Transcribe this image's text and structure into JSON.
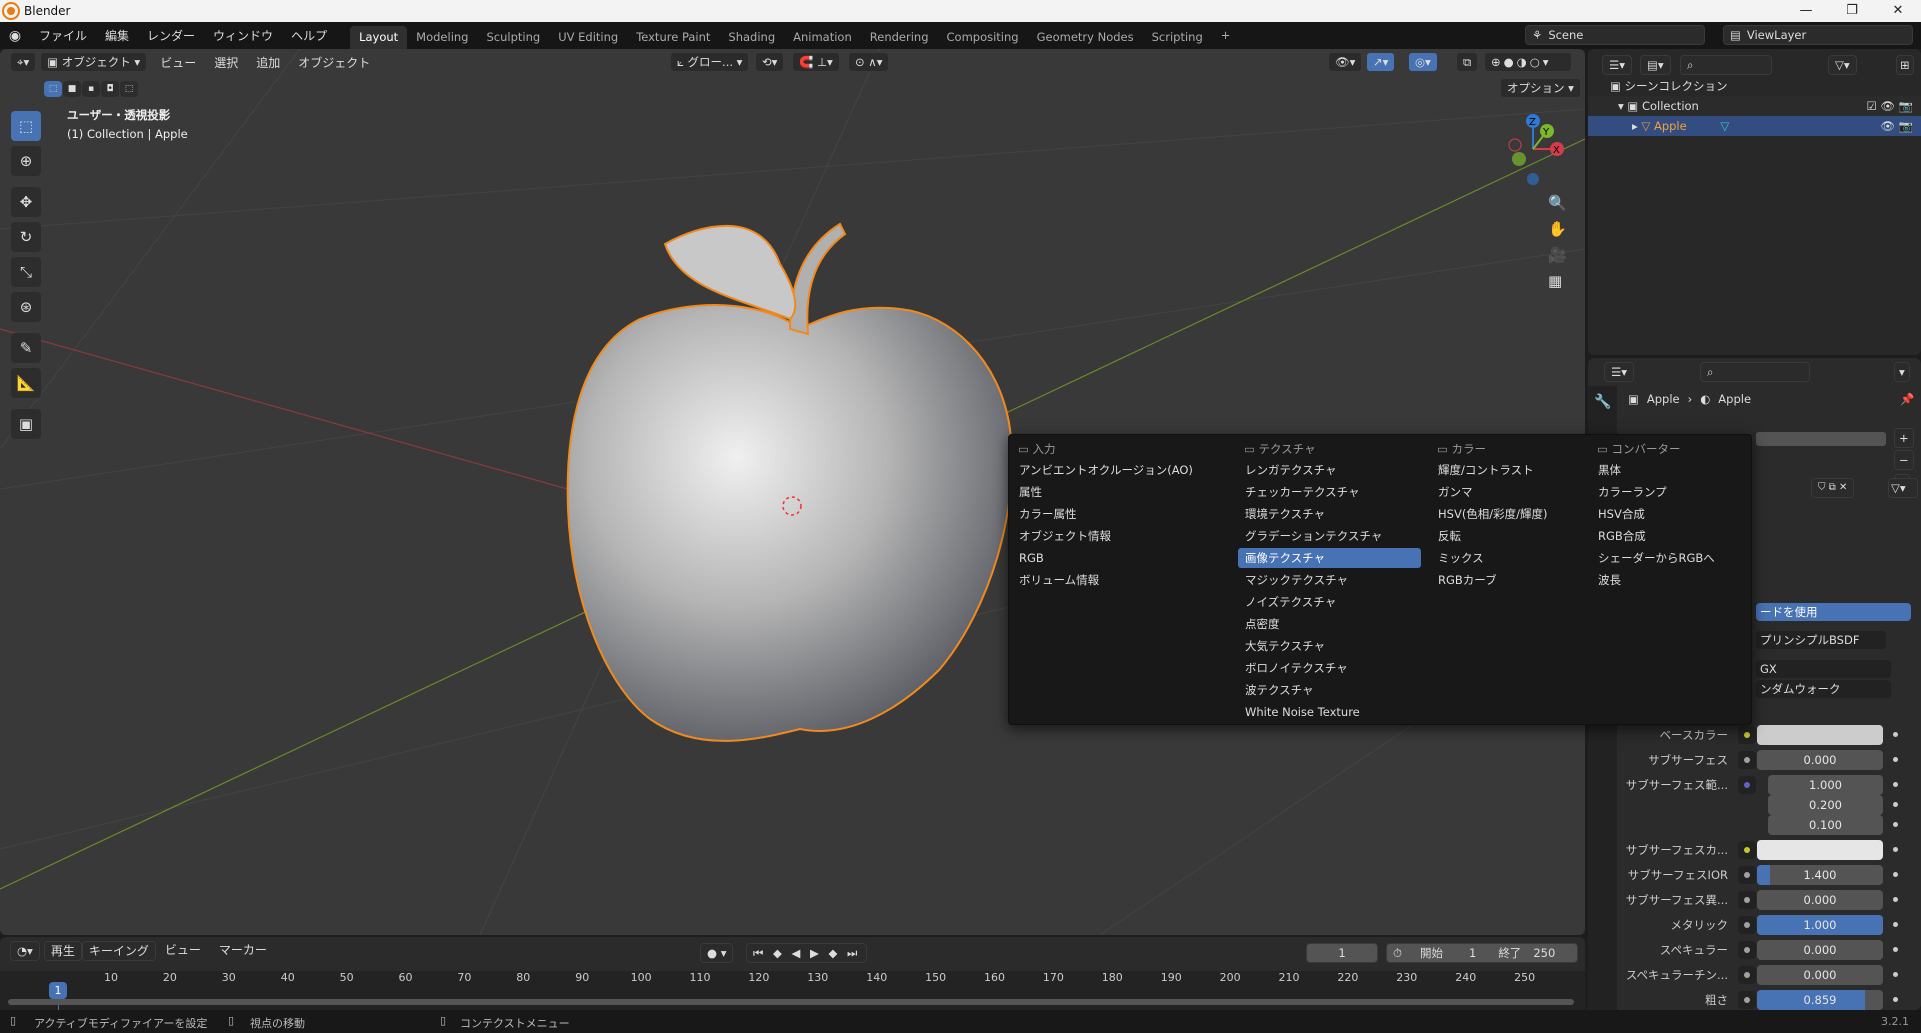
{
  "window": {
    "title": "Blender",
    "minimize": "—",
    "maximize": "❐",
    "close": "✕"
  },
  "topbar": {
    "menus": [
      "ファイル",
      "編集",
      "レンダー",
      "ウィンドウ",
      "ヘルプ"
    ],
    "workspaces": [
      "Layout",
      "Modeling",
      "Sculpting",
      "UV Editing",
      "Texture Paint",
      "Shading",
      "Animation",
      "Rendering",
      "Compositing",
      "Geometry Nodes",
      "Scripting"
    ],
    "active_workspace": "Layout",
    "add_tab": "+",
    "scene": "Scene",
    "view_layer": "ViewLayer"
  },
  "viewport": {
    "mode": "オブジェクト",
    "menus": [
      "ビュー",
      "選択",
      "追加",
      "オブジェクト"
    ],
    "transform": "グロー...",
    "options": "オプション",
    "view_name": "ユーザー・透視投影",
    "collection_info": "(1) Collection | Apple",
    "gizmo": {
      "x": "X",
      "y": "Y",
      "z": "Z"
    }
  },
  "outliner": {
    "scene_collection": "シーンコレクション",
    "collection": "Collection",
    "object": "Apple"
  },
  "add_menu": {
    "columns": [
      {
        "header": "入力",
        "items": [
          "アンビエントオクルージョン(AO)",
          "属性",
          "カラー属性",
          "オブジェクト情報",
          "RGB",
          "ボリューム情報"
        ]
      },
      {
        "header": "テクスチャ",
        "items": [
          "レンガテクスチャ",
          "チェッカーテクスチャ",
          "環境テクスチャ",
          "グラデーションテクスチャ",
          "画像テクスチャ",
          "マジックテクスチャ",
          "ノイズテクスチャ",
          "点密度",
          "大気テクスチャ",
          "ボロノイテクスチャ",
          "波テクスチャ",
          "White Noise Texture"
        ]
      },
      {
        "header": "カラー",
        "items": [
          "輝度/コントラスト",
          "ガンマ",
          "HSV(色相/彩度/輝度)",
          "反転",
          "ミックス",
          "RGBカーブ"
        ]
      },
      {
        "header": "コンバーター",
        "items": [
          "黒体",
          "カラーランプ",
          "HSV合成",
          "RGB合成",
          "シェーダーからRGBへ",
          "波長"
        ]
      }
    ],
    "highlighted": "画像テクスチャ"
  },
  "properties": {
    "breadcrumb_object": "Apple",
    "breadcrumb_material": "Apple",
    "use_nodes_partial": "ードを使用",
    "surface_partial": "プリンシプルBSDF",
    "distribution_partial": "GX",
    "subsurface_method_partial": "ンダムウォーク",
    "rows": [
      {
        "label": "ベースカラー",
        "socket": "#c7c729",
        "color": "#cccccc"
      },
      {
        "label": "サブサーフェス",
        "socket": "#a1a1a1",
        "value": "0.000",
        "fill": 0
      },
      {
        "label": "サブサーフェス範...",
        "socket": "#6363c7",
        "value": "1.000",
        "fill": 0,
        "vector": [
          "1.000",
          "0.200",
          "0.100"
        ]
      },
      {
        "label": "サブサーフェスカ...",
        "socket": "#c7c729",
        "color": "#e6e6e6"
      },
      {
        "label": "サブサーフェスIOR",
        "socket": "#a1a1a1",
        "value": "1.400",
        "fill": 0.1
      },
      {
        "label": "サブサーフェス異...",
        "socket": "#a1a1a1",
        "value": "0.000",
        "fill": 0
      },
      {
        "label": "メタリック",
        "socket": "#a1a1a1",
        "value": "1.000",
        "fill": 1
      },
      {
        "label": "スペキュラー",
        "socket": "#a1a1a1",
        "value": "0.000",
        "fill": 0
      },
      {
        "label": "スペキュラーチン...",
        "socket": "#a1a1a1",
        "value": "0.000",
        "fill": 0
      },
      {
        "label": "粗さ",
        "socket": "#a1a1a1",
        "value": "0.859",
        "fill": 0.859
      }
    ]
  },
  "timeline": {
    "menus": [
      "再生",
      "キーイング",
      "ビュー",
      "マーカー"
    ],
    "current_frame": "1",
    "start_label": "開始",
    "start": "1",
    "end_label": "終了",
    "end": "250",
    "ticks": [
      "10",
      "20",
      "30",
      "40",
      "50",
      "60",
      "70",
      "80",
      "90",
      "100",
      "110",
      "120",
      "130",
      "140",
      "150",
      "160",
      "170",
      "180",
      "190",
      "200",
      "210",
      "220",
      "230",
      "240",
      "250"
    ]
  },
  "statusbar": {
    "hints": [
      "アクティブモディファイアーを設定",
      "視点の移動",
      "コンテクストメニュー"
    ],
    "version": "3.2.1"
  }
}
